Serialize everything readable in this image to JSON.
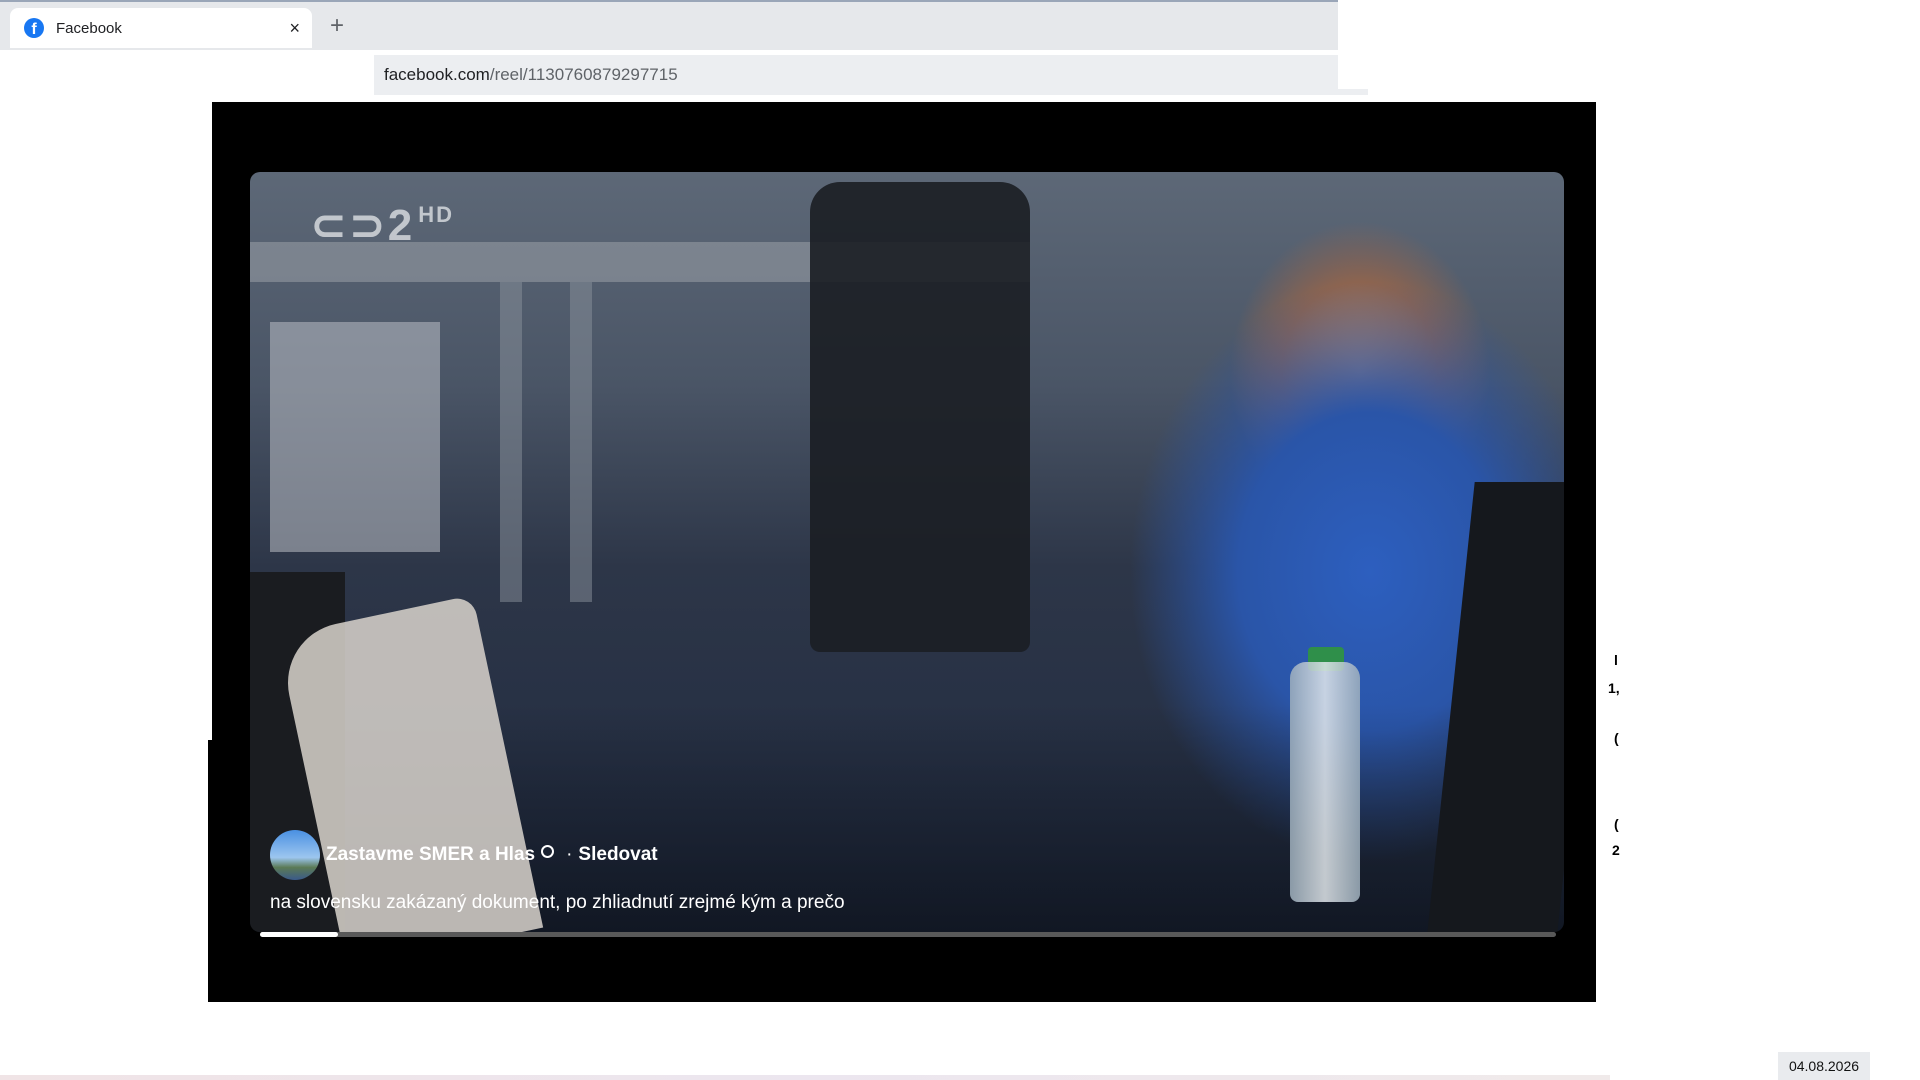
{
  "browser": {
    "tab": {
      "title": "Facebook",
      "close_icon": "×"
    },
    "new_tab_icon": "+",
    "address": {
      "host": "facebook.com",
      "path": "/reel/1130760879297715"
    }
  },
  "reel": {
    "channel_logo": {
      "text": "2",
      "suffix": "HD"
    },
    "author": {
      "name": "Zastavme SMER a Hlas",
      "visibility_icon": "globe-icon",
      "separator": "·",
      "follow_label": "Sledovat"
    },
    "caption": "na slovensku zakázaný dokument, po zhliadnutí zrejmé kým a prečo",
    "progress_fraction": 0.06
  },
  "clipped_edge": {
    "a": "l",
    "b": "1,",
    "c": "(",
    "d": "(",
    "e": "2"
  },
  "taskbar": {
    "date": "04.08.2026"
  },
  "colors": {
    "facebook_blue": "#1877f2",
    "video_bg": "#000000"
  }
}
